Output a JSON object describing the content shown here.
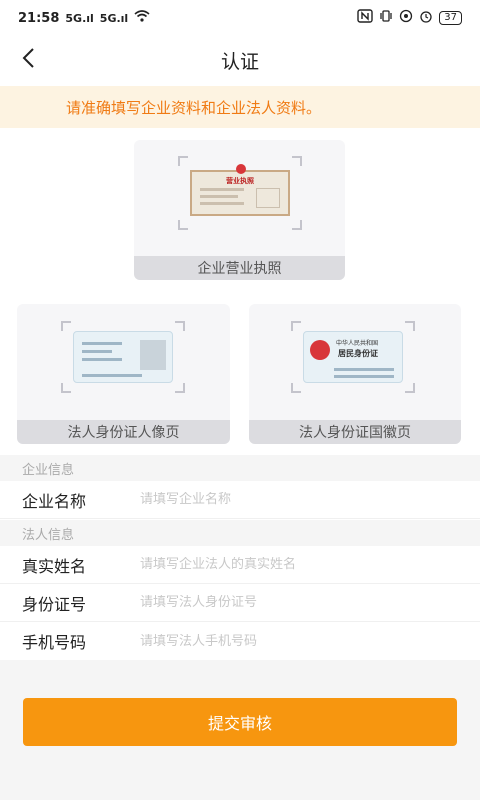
{
  "status_bar": {
    "time": "21:58",
    "signal1": "5G.ıl",
    "signal2": "5G.ıl",
    "battery": "37"
  },
  "nav": {
    "title": "认证"
  },
  "notice": {
    "text": "请准确填写企业资料和企业法人资料。"
  },
  "uploads": {
    "business_license": {
      "caption": "企业营业执照",
      "card_title": "营业执照"
    },
    "id_front": {
      "caption": "法人身份证人像页"
    },
    "id_back": {
      "caption": "法人身份证国徽页",
      "card_line1": "中华人民共和国",
      "card_line2": "居民身份证"
    }
  },
  "company_section": {
    "label": "企业信息",
    "name": {
      "label": "企业名称",
      "placeholder": "请填写企业名称"
    }
  },
  "legal_section": {
    "label": "法人信息",
    "real_name": {
      "label": "真实姓名",
      "placeholder": "请填写企业法人的真实姓名"
    },
    "id_number": {
      "label": "身份证号",
      "placeholder": "请填写法人身份证号"
    },
    "phone": {
      "label": "手机号码",
      "placeholder": "请填写法人手机号码"
    }
  },
  "submit": {
    "label": "提交审核"
  },
  "colors": {
    "accent": "#f7960f",
    "notice_bg": "#fdf3e1",
    "notice_text": "#f07b14"
  }
}
